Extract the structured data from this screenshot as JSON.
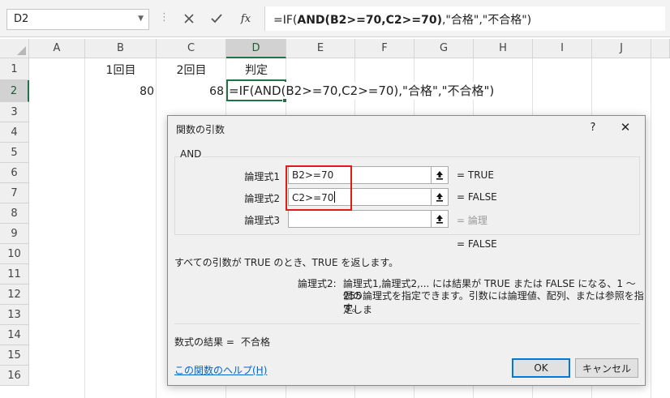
{
  "name_box": {
    "value": "D2"
  },
  "formula_bar": {
    "cancel_icon": "close-icon",
    "enter_icon": "check-icon",
    "fx_label": "fx",
    "formula": {
      "prefix": "=IF(",
      "bold": "AND(B2>=70,C2>=70)",
      "suffix": ",\"合格\",\"不合格\")"
    }
  },
  "sheet": {
    "columns": [
      "A",
      "B",
      "C",
      "D",
      "E",
      "F",
      "G",
      "H",
      "I",
      "J"
    ],
    "rows": [
      "1",
      "2",
      "3",
      "4",
      "5",
      "6",
      "7",
      "8",
      "9",
      "10",
      "11",
      "12",
      "13",
      "14",
      "15",
      "16"
    ],
    "selected_column": "D",
    "selected_row": "2",
    "cells": {
      "B1": "1回目",
      "C1": "2回目",
      "D1": "判定",
      "B2": "80",
      "C2": "68"
    },
    "editing_text": "=IF(AND(B2>=70,C2>=70),\"合格\",\"不合格\")"
  },
  "dialog": {
    "title": "関数の引数",
    "help_label": "?",
    "close_label": "✕",
    "function_name": "AND",
    "args": [
      {
        "label": "論理式1",
        "value": "B2>=70",
        "result": "= TRUE"
      },
      {
        "label": "論理式2",
        "value": "C2>=70",
        "result": "= FALSE"
      },
      {
        "label": "論理式3",
        "value": "",
        "result": "= 論理"
      }
    ],
    "overall_result": "= FALSE",
    "description": "すべての引数が TRUE のとき、TRUE を返します。",
    "arg_desc_label": "論理式2:",
    "arg_desc_lines": [
      "論理式1,論理式2,... には結果が TRUE または FALSE になる、1 〜 255",
      "個の論理式を指定できます。引数には論理値、配列、または参照を指定しま",
      "す。"
    ],
    "formula_result_label": "数式の結果 =",
    "formula_result_value": "不合格",
    "help_link": "この関数のヘルプ(H)",
    "ok_label": "OK",
    "cancel_label": "キャンセル",
    "highlight_color": "#e01b1b",
    "accent_color": "#217346"
  }
}
